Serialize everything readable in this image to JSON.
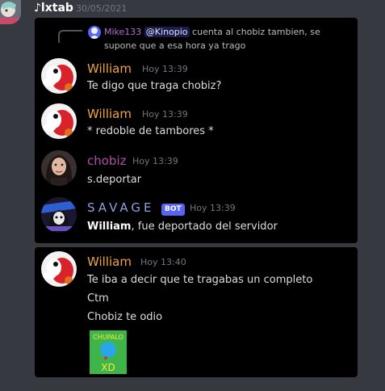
{
  "header": {
    "author": "♪lxtab",
    "date": "30/05/2021"
  },
  "reply": {
    "author": "Mike133",
    "mention": "@Kinopio",
    "text": " cuenta al chobiz tambien, se supone que a esa hora ya trago"
  },
  "messages": [
    {
      "author": "William",
      "time": "Hoy 13:39",
      "text": "Te digo que traga chobiz?",
      "color": "#f0a444"
    },
    {
      "author": "William",
      "time": "Hoy 13:39",
      "text": "* redoble de tambores *",
      "color": "#f0a444"
    },
    {
      "author": "chobiz",
      "time": "Hoy 13:39",
      "text": "s.deportar",
      "color": "#b050a8"
    },
    {
      "author": "SAVAGE",
      "bot_tag": "BOT",
      "time": "Hoy 13:39",
      "text_bold": "William",
      "text_rest": ", fue deportado del servidor",
      "color": "#8ea1e1"
    }
  ],
  "group2": {
    "author": "William",
    "time": "Hoy 13:40",
    "color": "#f0a444",
    "lines": [
      "Te iba a decir que te tragabas un completo",
      "Ctm",
      "Chobiz te odio"
    ],
    "image": {
      "top_text": "CHUPALO",
      "bottom_text": "XD"
    }
  }
}
